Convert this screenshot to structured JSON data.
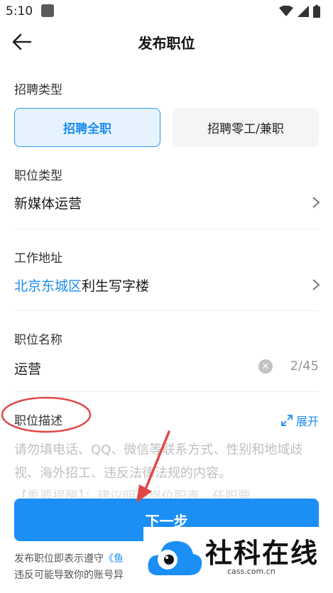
{
  "status_bar": {
    "time": "5:10"
  },
  "header": {
    "title": "发布职位"
  },
  "recruit_type": {
    "label": "招聘类型",
    "options": [
      "招聘全职",
      "招聘零工/兼职"
    ],
    "selected": "招聘全职"
  },
  "job_type": {
    "label": "职位类型",
    "value": "新媒体运营"
  },
  "work_address": {
    "label": "工作地址",
    "district": "北京东城区",
    "building": "利生写字楼"
  },
  "job_name": {
    "label": "职位名称",
    "value": "运营",
    "counter": "2/45"
  },
  "job_desc": {
    "label": "职位描述",
    "expand_label": "展开",
    "placeholder": "请勿填电话、QQ、微信等联系方式、性别和地域歧视、海外招工、违反法律法规的内容。",
    "hidden_hint": "【重要提醒】：建议明确岗位职责、任职要"
  },
  "next_button": {
    "label": "下一步"
  },
  "footer": {
    "line1_prefix": "发布职位即表示遵守",
    "line1_link": "《鱼",
    "line2": "违反可能导致你的账号异"
  },
  "watermark": {
    "title": "社科在线",
    "url": "cass.com.cn"
  },
  "colors": {
    "accent": "#1b8ff6",
    "annotation": "#e04848"
  }
}
